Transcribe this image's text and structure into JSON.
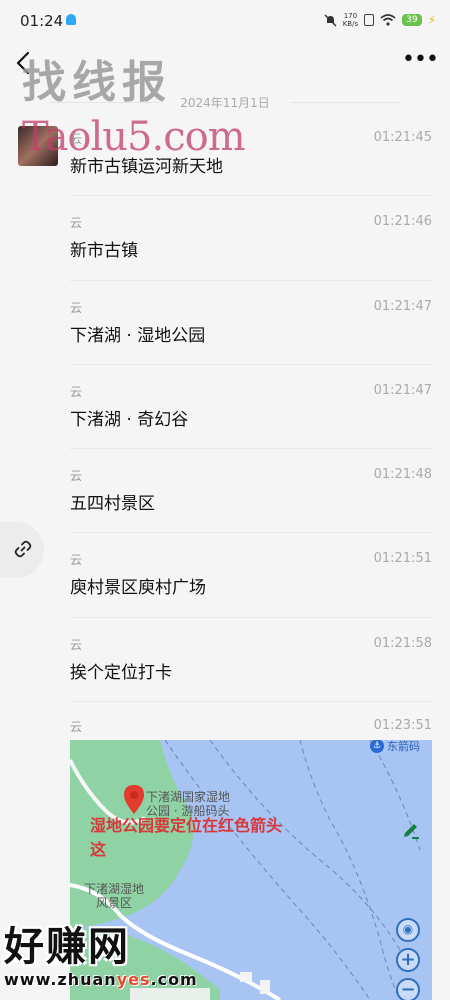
{
  "status_bar": {
    "time": "01:24",
    "net_speed_value": "170",
    "net_speed_unit": "KB/s",
    "battery": "39"
  },
  "watermarks": {
    "top_title": "找线报",
    "url": "Taolu5.com",
    "bottom_title": "好赚网",
    "bottom_url_prefix": "www.zhuan",
    "bottom_url_highlight": "yes",
    "bottom_url_suffix": ".com"
  },
  "chat": {
    "date_separator": "2024年11月1日",
    "messages": [
      {
        "sender": "云",
        "time": "01:21:45",
        "text": "新市古镇运河新天地"
      },
      {
        "sender": "云",
        "time": "01:21:46",
        "text": "新市古镇"
      },
      {
        "sender": "云",
        "time": "01:21:47",
        "text": "下渚湖 · 湿地公园"
      },
      {
        "sender": "云",
        "time": "01:21:47",
        "text": "下渚湖 · 奇幻谷"
      },
      {
        "sender": "云",
        "time": "01:21:48",
        "text": "五四村景区"
      },
      {
        "sender": "云",
        "time": "01:21:51",
        "text": "庾村景区庾村广场"
      },
      {
        "sender": "云",
        "time": "01:21:58",
        "text": "挨个定位打卡"
      }
    ],
    "last_message": {
      "sender": "云",
      "time": "01:23:51"
    }
  },
  "map": {
    "poi_label": "东箭码",
    "place_label_line1": "下渚湖国家湿地",
    "place_label_line2": "公园 · 游船码头",
    "area_label_line1": "下渚湖湿地",
    "area_label_line2": "风景区",
    "annotation_line1": "湿地公园要定位在红色箭头",
    "annotation_line2": "这",
    "colors": {
      "water": "#a7c4f3",
      "land": "#8fd3a4",
      "pin": "#e23b2f",
      "annotation": "#d9383a"
    }
  },
  "icons": {
    "back": "chevron-left-icon",
    "more": "more-dots-icon",
    "link": "link-icon",
    "edit": "pencil-icon",
    "locate": "locate-icon",
    "zoom_in": "zoom-in-icon",
    "zoom_out": "zoom-out-icon"
  }
}
